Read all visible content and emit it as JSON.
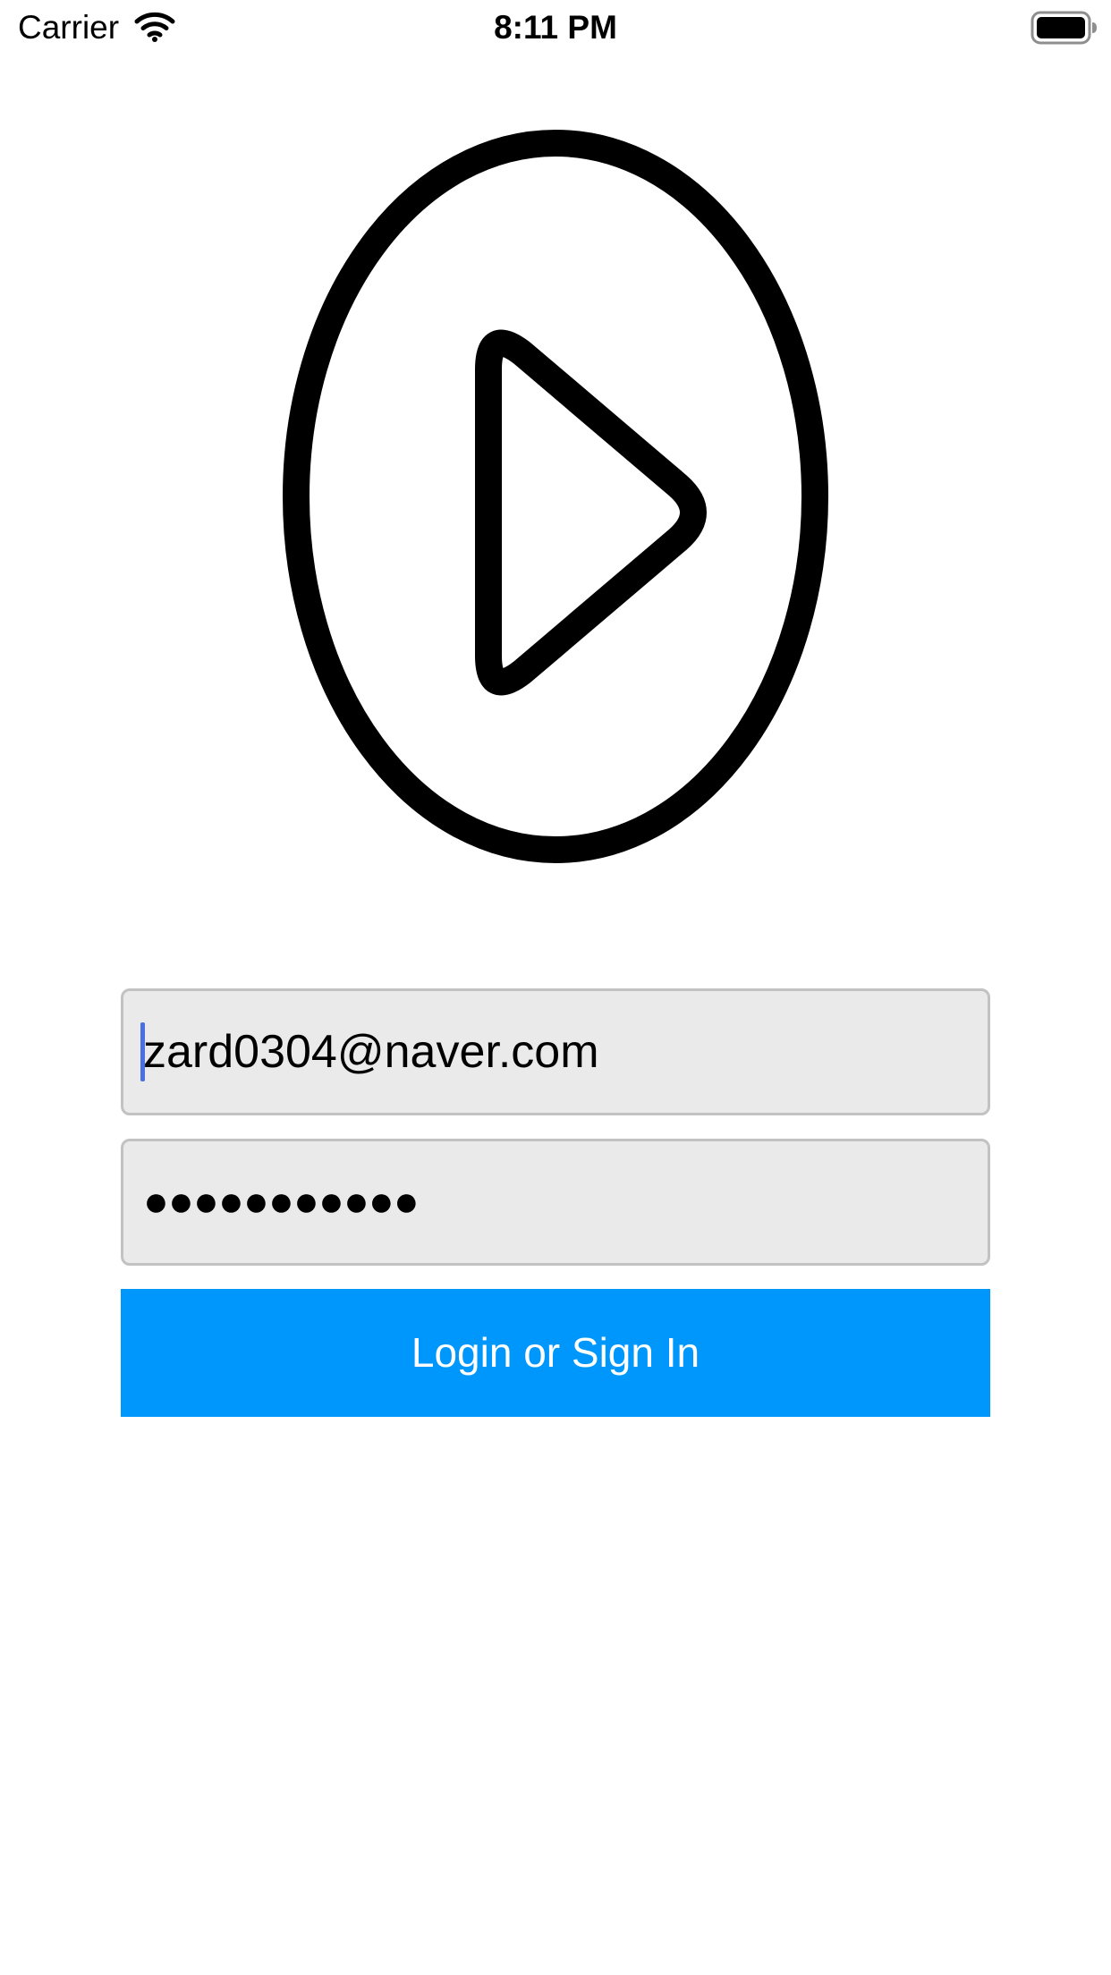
{
  "status_bar": {
    "carrier": "Carrier",
    "time": "8:11 PM",
    "wifi_icon": "wifi-icon",
    "battery_icon": "battery-full-icon"
  },
  "logo": {
    "icon": "play-circle-icon"
  },
  "login_form": {
    "email_value": "zard0304@naver.com",
    "password_value": "●●●●●●●●●●●",
    "submit_label": "Login or Sign In"
  },
  "colors": {
    "button_background": "#0097fd",
    "button_text": "#ffffff",
    "field_background": "#eaeaea",
    "field_border": "#c2c2c2",
    "caret": "#4a6fe0"
  }
}
